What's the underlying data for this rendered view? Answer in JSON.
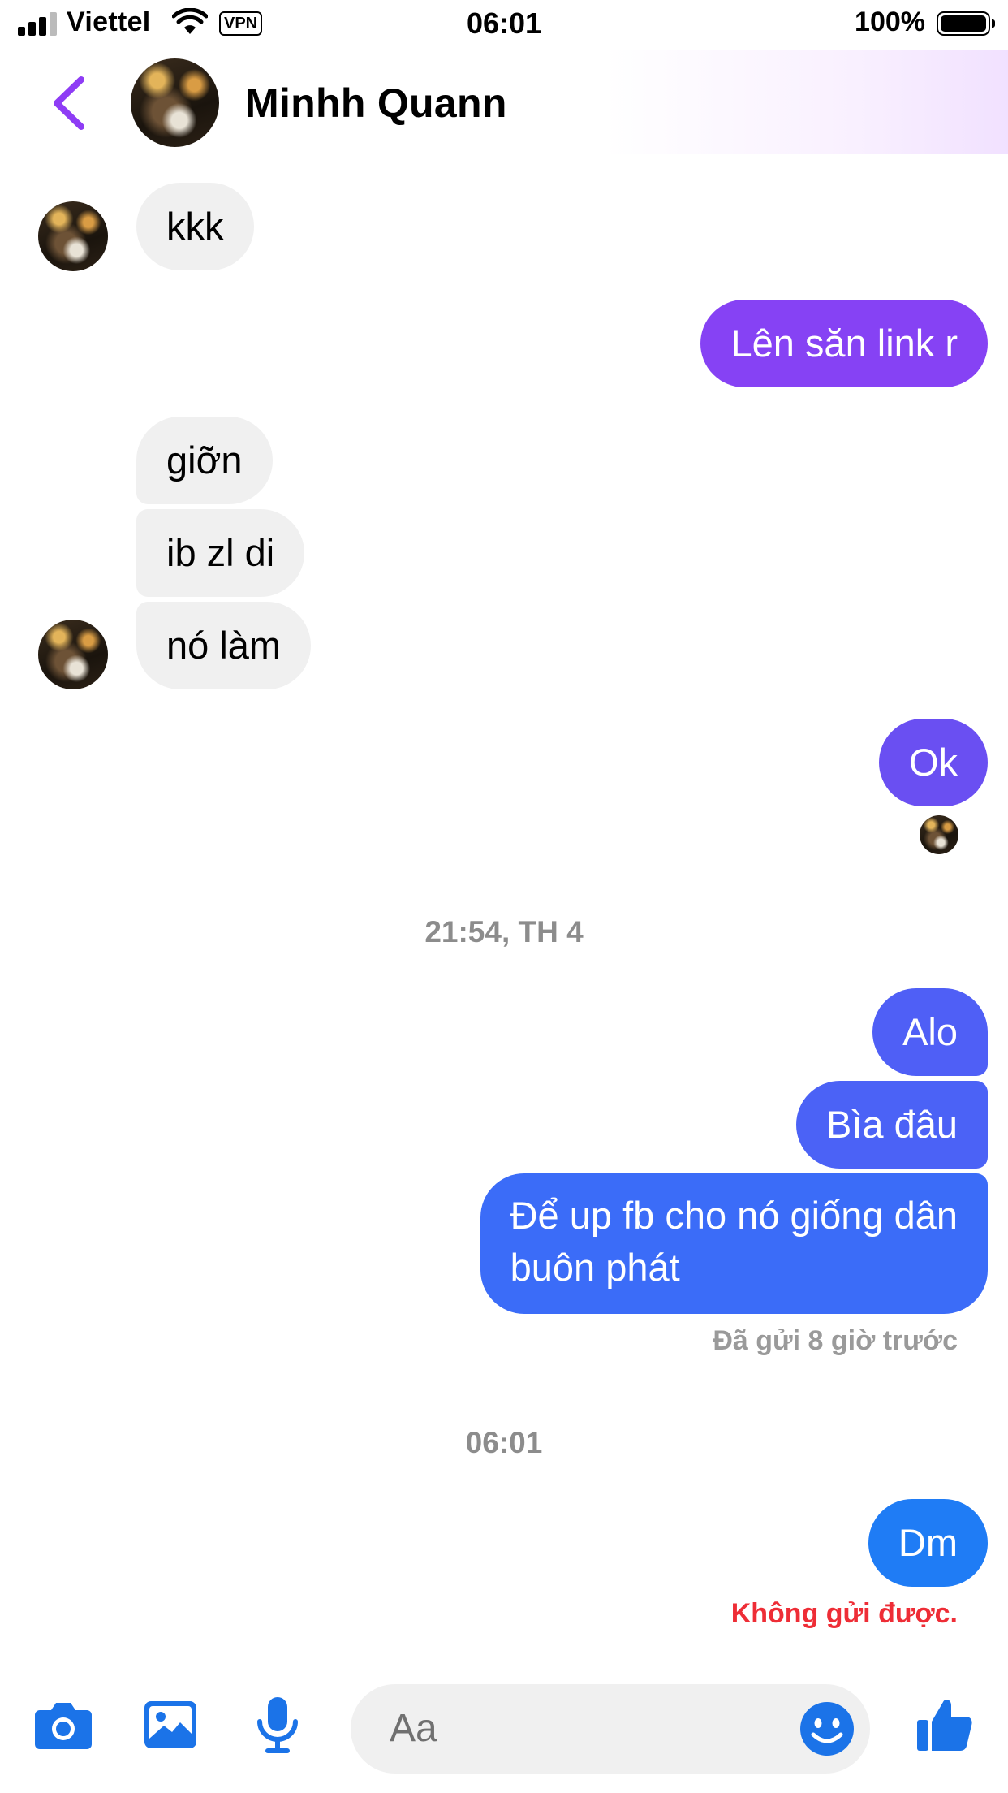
{
  "status": {
    "carrier": "Viettel",
    "vpn": "VPN",
    "time": "06:01",
    "battery": "100%"
  },
  "header": {
    "contact_name": "Minhh Quann"
  },
  "messages": [
    {
      "dir": "in",
      "text": "kkk"
    },
    {
      "dir": "out",
      "text": "Lên săn link r"
    },
    {
      "dir": "in",
      "text": "giỡn"
    },
    {
      "dir": "in",
      "text": "ib zl di"
    },
    {
      "dir": "in",
      "text": "nó làm"
    },
    {
      "dir": "out",
      "text": "Ok"
    },
    {
      "dir": "out",
      "text": "Alo"
    },
    {
      "dir": "out",
      "text": "Bìa đâu"
    },
    {
      "dir": "out",
      "text_line1": "Để up fb cho nó giống dân",
      "text_line2": "buôn phát"
    },
    {
      "dir": "out",
      "text": "Dm"
    }
  ],
  "timestamps": [
    "21:54, TH 4",
    "06:01"
  ],
  "sent_status": "Đã gửi 8 giờ trước",
  "error_status": "Không gửi được.",
  "composer": {
    "placeholder": "Aa",
    "icons": [
      "camera-icon",
      "image-icon",
      "microphone-icon",
      "emoji-icon",
      "thumbs-up-icon"
    ]
  },
  "colors": {
    "accent": "#8e3cf5",
    "bubble_purple": "#8642f4",
    "bubble_violet": "#6a4ff2",
    "bubble_indigo": "#4f5ff6",
    "bubble_blue": "#3b6cf8",
    "bubble_bright_blue": "#1f7cf5",
    "icon_blue": "#1b73e8",
    "error_red": "#ee2d36"
  }
}
